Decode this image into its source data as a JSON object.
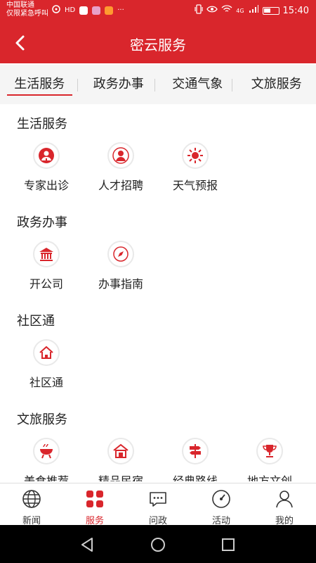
{
  "status_bar": {
    "carrier_line1": "中国联通",
    "carrier_line2": "仅限紧急呼叫",
    "hd_label": "HD",
    "network": "4G",
    "time": "15:40"
  },
  "header": {
    "title": "密云服务"
  },
  "tabs": [
    {
      "label": "生活服务",
      "active": true
    },
    {
      "label": "政务办事",
      "active": false
    },
    {
      "label": "交通气象",
      "active": false
    },
    {
      "label": "文旅服务",
      "active": false
    }
  ],
  "sections": [
    {
      "title": "生活服务",
      "items": [
        {
          "label": "专家出诊",
          "icon": "doctor-icon"
        },
        {
          "label": "人才招聘",
          "icon": "person-icon"
        },
        {
          "label": "天气预报",
          "icon": "sun-icon"
        }
      ]
    },
    {
      "title": "政务办事",
      "items": [
        {
          "label": "开公司",
          "icon": "building-icon"
        },
        {
          "label": "办事指南",
          "icon": "compass-icon"
        }
      ]
    },
    {
      "title": "社区通",
      "items": [
        {
          "label": "社区通",
          "icon": "house-icon"
        }
      ]
    },
    {
      "title": "文旅服务",
      "items": [
        {
          "label": "美食推荐",
          "icon": "bbq-icon"
        },
        {
          "label": "精品民宿",
          "icon": "lodge-icon"
        },
        {
          "label": "经典路线",
          "icon": "signpost-icon"
        },
        {
          "label": "地方文创",
          "icon": "trophy-icon"
        }
      ]
    }
  ],
  "bottom_nav": [
    {
      "label": "新闻",
      "icon": "globe-icon",
      "active": false
    },
    {
      "label": "服务",
      "icon": "grid-icon",
      "active": true
    },
    {
      "label": "问政",
      "icon": "chat-icon",
      "active": false
    },
    {
      "label": "活动",
      "icon": "gauge-icon",
      "active": false
    },
    {
      "label": "我的",
      "icon": "user-icon",
      "active": false
    }
  ],
  "colors": {
    "brand_red": "#d9262c",
    "icon_red": "#d9262c"
  }
}
